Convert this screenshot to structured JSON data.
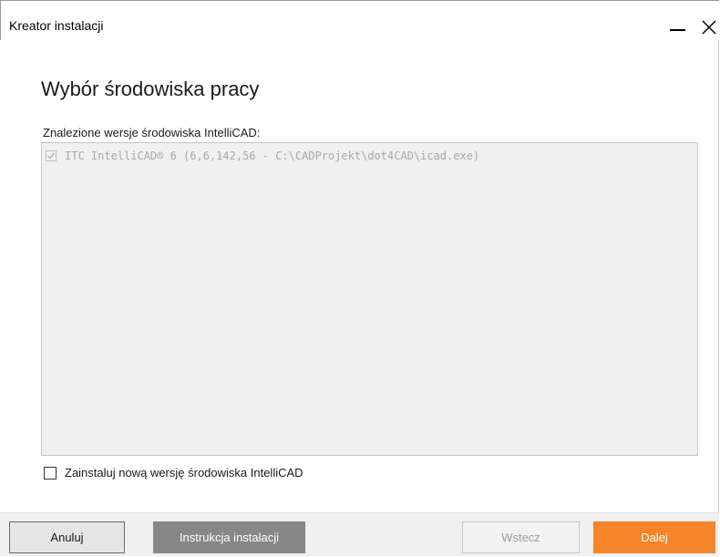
{
  "window": {
    "title": "Kreator instalacji",
    "minimize_icon": "minimize-icon",
    "close_icon": "close-icon"
  },
  "page": {
    "heading": "Wybór środowiska pracy"
  },
  "environments": {
    "label": "Znalezione wersje środowiska IntelliCAD:",
    "items": [
      {
        "text": "ITC IntelliCAD® 6 (6,6,142,56 - C:\\CADProjekt\\dot4CAD\\icad.exe)",
        "checked": true,
        "disabled": true
      }
    ]
  },
  "install_new": {
    "label": "Zainstaluj nową wersję środowiska IntelliCAD",
    "checked": false
  },
  "footer": {
    "cancel_label": "Anuluj",
    "guide_label": "Instrukcja instalacji",
    "back_label": "Wstecz",
    "next_label": "Dalej"
  },
  "colors": {
    "accent": "#f5842a",
    "secondary_button": "#878787",
    "list_background": "#f0f0f0"
  }
}
